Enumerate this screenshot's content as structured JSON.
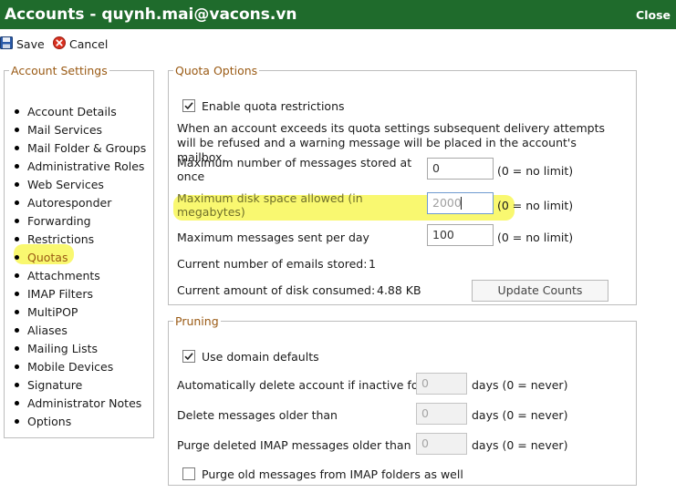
{
  "window": {
    "title": "Accounts - quynh.mai@vacons.vn",
    "close_label": "Close"
  },
  "toolbar": {
    "save_label": "Save",
    "cancel_label": "Cancel"
  },
  "sidebar": {
    "legend": "Account Settings",
    "active": "Quotas",
    "items": [
      "Account Details",
      "Mail Services",
      "Mail Folder & Groups",
      "Administrative Roles",
      "Web Services",
      "Autoresponder",
      "Forwarding",
      "Restrictions",
      "Quotas",
      "Attachments",
      "IMAP Filters",
      "MultiPOP",
      "Aliases",
      "Mailing Lists",
      "Mobile Devices",
      "Signature",
      "Administrator Notes",
      "Options"
    ]
  },
  "quota": {
    "legend": "Quota Options",
    "enable_label": "Enable quota restrictions",
    "enable_checked": true,
    "description": "When an account exceeds its quota settings subsequent delivery attempts will be refused and a warning message will be placed in the account's mailbox.",
    "max_messages_label": "Maximum number of messages stored at once",
    "max_messages_value": "0",
    "max_messages_hint": "(0 = no limit)",
    "max_disk_label": "Maximum disk space allowed (in megabytes)",
    "max_disk_value": "2000",
    "max_disk_hint": "(0 = no limit)",
    "max_sent_label": "Maximum messages sent per day",
    "max_sent_value": "100",
    "max_sent_hint": "(0 = no limit)",
    "current_emails_label": "Current number of emails stored:",
    "current_emails_value": "1",
    "current_disk_label": "Current amount of disk consumed:",
    "current_disk_value": "4.88 KB",
    "update_button": "Update Counts"
  },
  "pruning": {
    "legend": "Pruning",
    "use_defaults_label": "Use domain defaults",
    "use_defaults_checked": true,
    "inactive_label": "Automatically delete account if inactive for",
    "inactive_value": "0",
    "inactive_unit": "days (0 = never)",
    "older_label": "Delete messages older than",
    "older_value": "0",
    "older_unit": "days (0 = never)",
    "purge_label": "Purge deleted IMAP messages older than",
    "purge_value": "0",
    "purge_unit": "days (0 = never)",
    "purge_folders_label": "Purge old messages from IMAP folders as well",
    "purge_folders_checked": false
  },
  "colors": {
    "titlebar": "#1f6b2c",
    "legend": "#9a5a14",
    "highlight": "#f8f760"
  }
}
